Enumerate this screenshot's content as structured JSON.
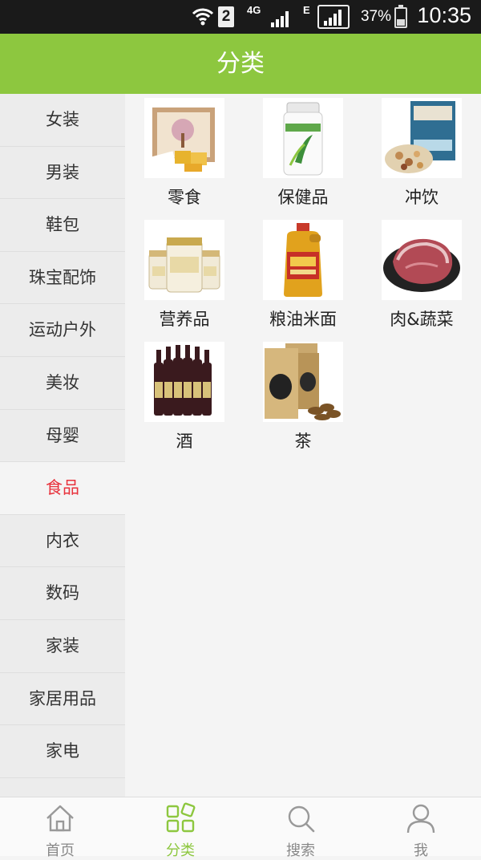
{
  "status_bar": {
    "sim_slot": "2",
    "network": "4G",
    "network2": "E",
    "battery": "37%",
    "time": "10:35"
  },
  "header": {
    "title": "分类"
  },
  "sidebar": {
    "items": [
      {
        "label": "女装",
        "active": false
      },
      {
        "label": "男装",
        "active": false
      },
      {
        "label": "鞋包",
        "active": false
      },
      {
        "label": "珠宝配饰",
        "active": false
      },
      {
        "label": "运动户外",
        "active": false
      },
      {
        "label": "美妆",
        "active": false
      },
      {
        "label": "母婴",
        "active": false
      },
      {
        "label": "食品",
        "active": true
      },
      {
        "label": "内衣",
        "active": false
      },
      {
        "label": "数码",
        "active": false
      },
      {
        "label": "家装",
        "active": false
      },
      {
        "label": "家居用品",
        "active": false
      },
      {
        "label": "家电",
        "active": false
      }
    ]
  },
  "categories": [
    {
      "label": "零食",
      "icon": "snack-box-image"
    },
    {
      "label": "保健品",
      "icon": "supplement-jar-image"
    },
    {
      "label": "冲饮",
      "icon": "granola-bag-image"
    },
    {
      "label": "营养品",
      "icon": "bird-nest-jars-image"
    },
    {
      "label": "粮油米面",
      "icon": "cooking-oil-bottle-image"
    },
    {
      "label": "肉&蔬菜",
      "icon": "raw-meat-image"
    },
    {
      "label": "酒",
      "icon": "wine-bottles-image"
    },
    {
      "label": "茶",
      "icon": "tea-bags-image"
    }
  ],
  "tabbar": {
    "tabs": [
      {
        "label": "首页",
        "icon": "home-icon",
        "active": false
      },
      {
        "label": "分类",
        "icon": "category-grid-icon",
        "active": true
      },
      {
        "label": "搜索",
        "icon": "search-icon",
        "active": false
      },
      {
        "label": "我",
        "icon": "user-icon",
        "active": false
      }
    ]
  },
  "colors": {
    "accent": "#8dc73f",
    "active_sidebar_text": "#e8323c",
    "sidebar_bg": "#ececec",
    "content_bg": "#f4f4f4"
  }
}
